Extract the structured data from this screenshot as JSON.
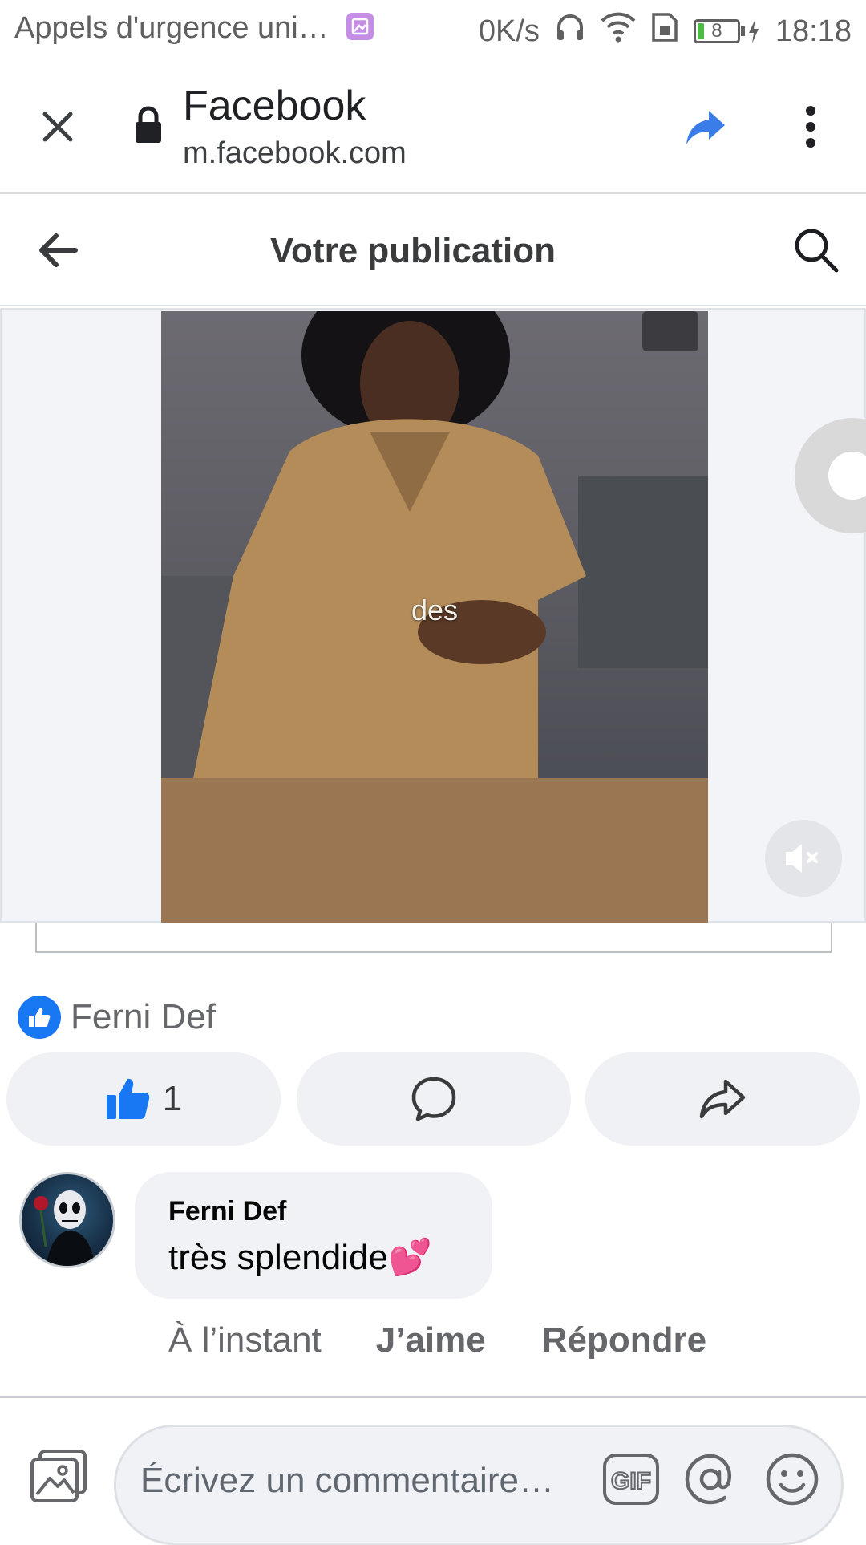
{
  "status_bar": {
    "notification_text": "Appels d'urgence uni…",
    "network_speed": "0K/s",
    "battery": "8",
    "time": "18:18"
  },
  "browser": {
    "title": "Facebook",
    "url": "m.facebook.com"
  },
  "page_header": {
    "title": "Votre publication"
  },
  "video": {
    "caption": "des"
  },
  "reactions": {
    "reactor_name": "Ferni Def"
  },
  "actions": {
    "like_count": "1"
  },
  "comment": {
    "author": "Ferni Def",
    "text": "très splendide",
    "emoji": "💕",
    "time": "À l’instant",
    "like_label": "J’aime",
    "reply_label": "Répondre"
  },
  "composer": {
    "placeholder": "Écrivez un commentaire…"
  },
  "colors": {
    "facebook_blue": "#1877f2",
    "share_blue": "#3b7de8",
    "secondary_text": "#65676b",
    "button_bg": "#eff1f4"
  }
}
